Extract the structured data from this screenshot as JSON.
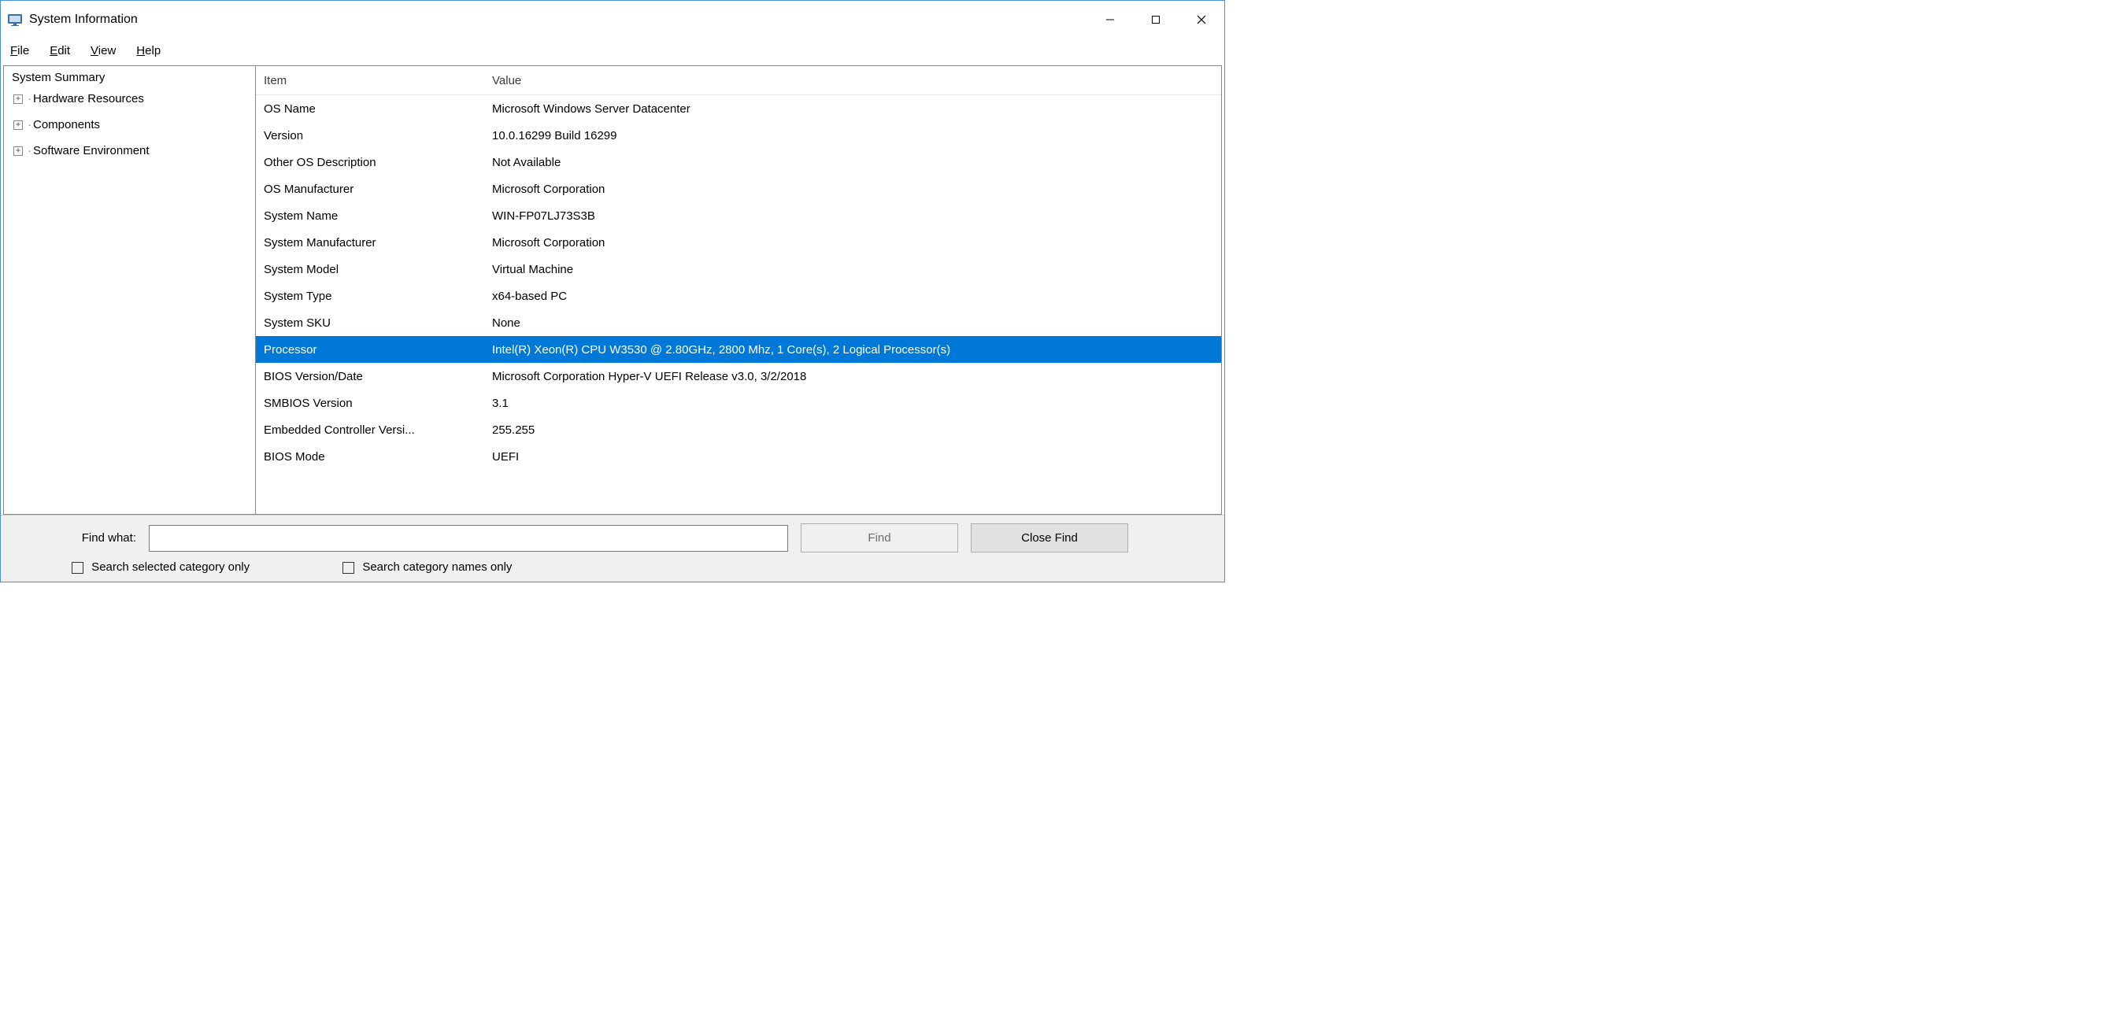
{
  "window": {
    "title": "System Information"
  },
  "menu": {
    "file": "File",
    "edit": "Edit",
    "view": "View",
    "help": "Help"
  },
  "tree": {
    "root": "System Summary",
    "children": [
      {
        "label": "Hardware Resources"
      },
      {
        "label": "Components"
      },
      {
        "label": "Software Environment"
      }
    ]
  },
  "list": {
    "headers": {
      "item": "Item",
      "value": "Value"
    },
    "rows": [
      {
        "item": "OS Name",
        "value": "Microsoft Windows Server Datacenter",
        "selected": false
      },
      {
        "item": "Version",
        "value": "10.0.16299 Build 16299",
        "selected": false
      },
      {
        "item": "Other OS Description",
        "value": "Not Available",
        "selected": false
      },
      {
        "item": "OS Manufacturer",
        "value": "Microsoft Corporation",
        "selected": false
      },
      {
        "item": "System Name",
        "value": "WIN-FP07LJ73S3B",
        "selected": false
      },
      {
        "item": "System Manufacturer",
        "value": "Microsoft Corporation",
        "selected": false
      },
      {
        "item": "System Model",
        "value": "Virtual Machine",
        "selected": false
      },
      {
        "item": "System Type",
        "value": "x64-based PC",
        "selected": false
      },
      {
        "item": "System SKU",
        "value": "None",
        "selected": false
      },
      {
        "item": "Processor",
        "value": "Intel(R) Xeon(R) CPU           W3530  @ 2.80GHz, 2800 Mhz, 1 Core(s), 2 Logical Processor(s)",
        "selected": true
      },
      {
        "item": "BIOS Version/Date",
        "value": "Microsoft Corporation Hyper-V UEFI Release v3.0, 3/2/2018",
        "selected": false
      },
      {
        "item": "SMBIOS Version",
        "value": "3.1",
        "selected": false
      },
      {
        "item": "Embedded Controller Versi...",
        "value": "255.255",
        "selected": false
      },
      {
        "item": "BIOS Mode",
        "value": "UEFI",
        "selected": false
      }
    ]
  },
  "find": {
    "label": "Find what:",
    "value": "",
    "find_btn": "Find",
    "close_btn": "Close Find",
    "check1": "Search selected category only",
    "check2": "Search category names only"
  }
}
